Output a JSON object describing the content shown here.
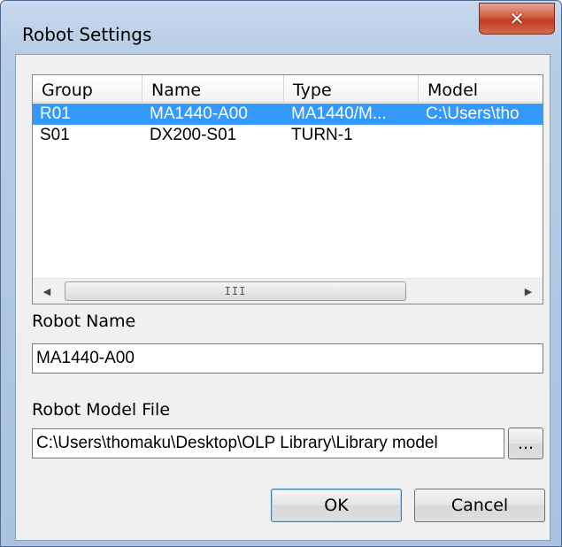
{
  "window": {
    "title": "Robot Settings",
    "close_icon": "close-icon"
  },
  "robot_list": {
    "columns": [
      "Group",
      "Name",
      "Type",
      "Model"
    ],
    "rows": [
      {
        "group": "R01",
        "name": "MA1440-A00",
        "type": "MA1440/M...",
        "model": "C:\\Users\\tho",
        "selected": true
      },
      {
        "group": "S01",
        "name": "DX200-S01",
        "type": "TURN-1",
        "model": "",
        "selected": false
      }
    ],
    "scroll_left_icon": "scroll-left-arrow-icon",
    "scroll_right_icon": "scroll-right-arrow-icon",
    "grip": "III"
  },
  "robot_name": {
    "label": "Robot Name",
    "value": "MA1440-A00"
  },
  "robot_model_file": {
    "label": "Robot Model File",
    "value": "C:\\Users\\thomaku\\Desktop\\OLP Library\\Library model",
    "browse_label": "..."
  },
  "buttons": {
    "ok": "OK",
    "cancel": "Cancel"
  },
  "colors": {
    "selection": "#3399ff",
    "close_button": "#c13b22"
  }
}
